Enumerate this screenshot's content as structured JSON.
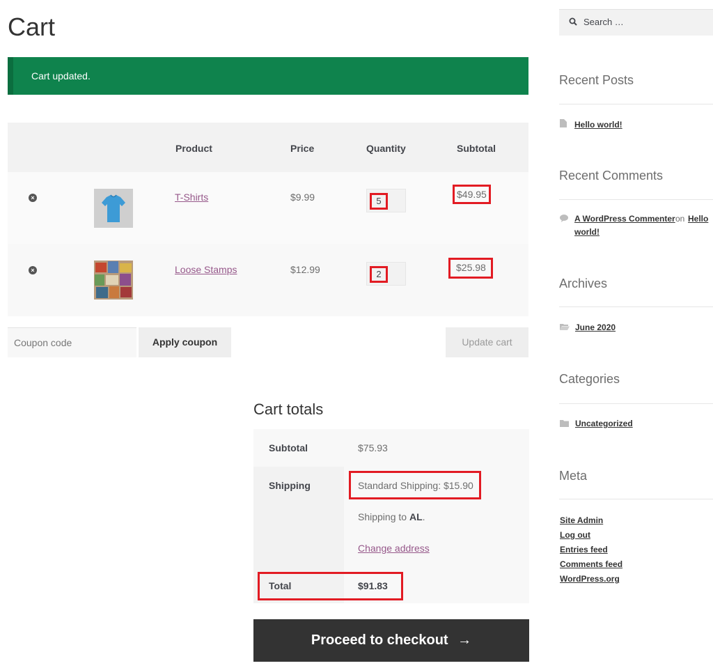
{
  "page": {
    "title": "Cart"
  },
  "notice": {
    "text": "Cart updated."
  },
  "table": {
    "headers": [
      "Product",
      "Price",
      "Quantity",
      "Subtotal"
    ],
    "items": [
      {
        "name": "T-Shirts",
        "price": "$9.99",
        "quantity": "5",
        "subtotal": "$49.95",
        "remove": "×",
        "thumb": "t-shirt-thumbnail"
      },
      {
        "name": "Loose Stamps",
        "price": "$12.99",
        "quantity": "2",
        "subtotal": "$25.98",
        "remove": "×",
        "thumb": "stamps-thumbnail"
      }
    ]
  },
  "actions": {
    "coupon_placeholder": "Coupon code",
    "apply_coupon": "Apply coupon",
    "update_cart": "Update cart"
  },
  "totals": {
    "title": "Cart totals",
    "subtotal_label": "Subtotal",
    "subtotal_value": "$75.93",
    "shipping_label": "Shipping",
    "shipping_method": "Standard Shipping: $15.90",
    "shipping_to_prefix": "Shipping to",
    "shipping_to_value": "AL",
    "shipping_to_suffix": ".",
    "change_address": "Change address",
    "total_label": "Total",
    "total_value": "$91.83"
  },
  "checkout": {
    "label": "Proceed to checkout",
    "arrow": "→"
  },
  "sidebar": {
    "search_placeholder": "Search …",
    "recent_posts_title": "Recent Posts",
    "recent_posts": [
      "Hello world!"
    ],
    "recent_comments_title": "Recent Comments",
    "comment_author": "A WordPress Commenter",
    "comment_on": "on",
    "comment_post_1": "Hello",
    "comment_post_2": "world!",
    "archives_title": "Archives",
    "archives": [
      "June 2020"
    ],
    "categories_title": "Categories",
    "categories": [
      "Uncategorized"
    ],
    "meta_title": "Meta",
    "meta_links": [
      "Site Admin",
      "Log out",
      "Entries feed",
      "Comments feed",
      "WordPress.org"
    ]
  },
  "colors": {
    "notice_bg": "#0f834d",
    "link": "#96588a",
    "highlight": "#e21b23",
    "checkout_bg": "#333333"
  }
}
